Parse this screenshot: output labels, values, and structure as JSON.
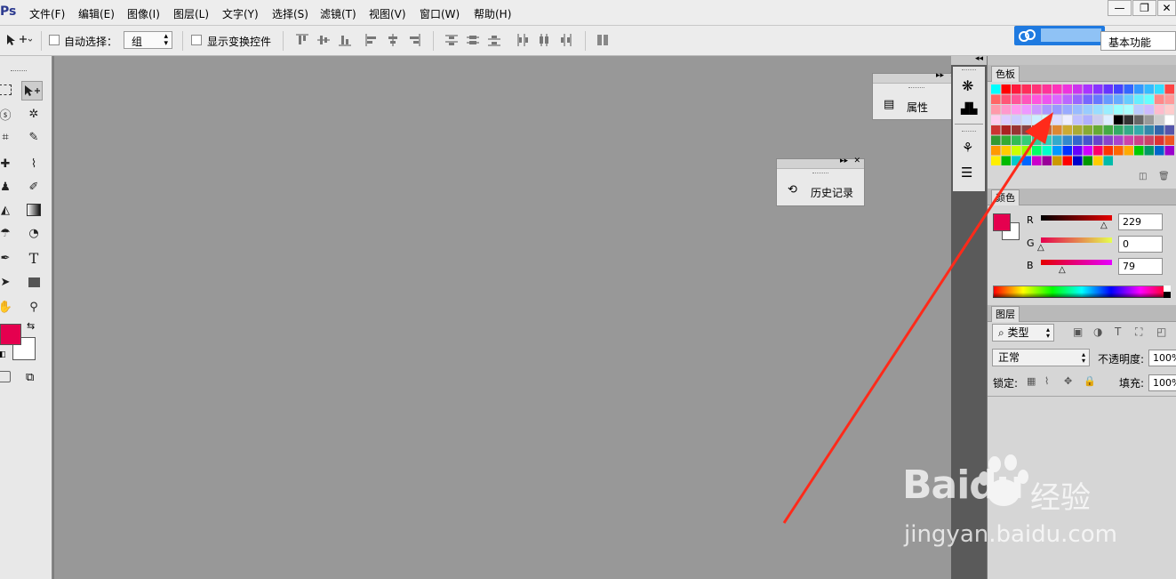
{
  "app": {
    "logo": "Ps"
  },
  "menu": [
    "文件(F)",
    "编辑(E)",
    "图像(I)",
    "图层(L)",
    "文字(Y)",
    "选择(S)",
    "滤镜(T)",
    "视图(V)",
    "窗口(W)",
    "帮助(H)"
  ],
  "window_controls": {
    "minimize": "—",
    "restore": "❐",
    "close": "✕"
  },
  "options": {
    "auto_select_label": "自动选择：",
    "auto_select_value": "组",
    "show_transform_label": "显示变换控件",
    "workspace": "基本功能"
  },
  "panels": {
    "properties": {
      "label": "属性"
    },
    "history": {
      "label": "历史记录"
    },
    "swatches": {
      "tab": "色板"
    },
    "color": {
      "tab": "颜色",
      "r_label": "R",
      "r_value": "229",
      "g_label": "G",
      "g_value": "0",
      "b_label": "B",
      "b_value": "79",
      "foreground": "#e5004f",
      "background": "#ffffff"
    },
    "layers": {
      "tab": "图层",
      "filter_kind": "类型",
      "blend_mode": "正常",
      "opacity_label": "不透明度:",
      "opacity_value": "100%",
      "lock_label": "锁定:",
      "fill_label": "填充:",
      "fill_value": "100%"
    }
  },
  "toolbox": {
    "foreground": "#e5004f",
    "background": "#ffffff"
  },
  "watermark": {
    "brand": "Baidu",
    "suffix": "经验",
    "url": "jingyan.baidu.com"
  },
  "annotation": {
    "arrow_color": "#ff2a1a"
  }
}
